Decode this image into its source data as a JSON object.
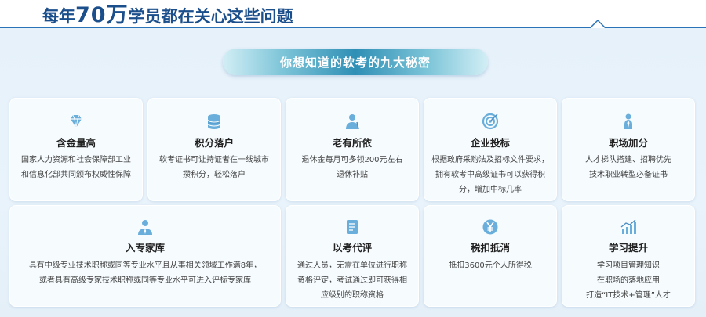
{
  "header": {
    "title_part1": "每年",
    "title_number": "70万",
    "title_part2": "学员都在关心这些问题"
  },
  "banner": {
    "label": "你想知道的软考的九大秘密"
  },
  "cards": [
    {
      "title": "含金量高",
      "icon": "diamond-icon",
      "lines": [
        "国家人力资源和社会保障部工业",
        "和信息化部共同颁布权威性保障"
      ]
    },
    {
      "title": "积分落户",
      "icon": "coin-stack-icon",
      "lines": [
        "软考证书可让持证者在一线城市",
        "攒积分，轻松落户"
      ]
    },
    {
      "title": "老有所依",
      "icon": "elder-person-icon",
      "lines": [
        "退休金每月可多领200元左右",
        "退休补贴"
      ]
    },
    {
      "title": "企业投标",
      "icon": "target-icon",
      "lines": [
        "根据政府采购法及招标文件要求，",
        "拥有软考中高级证书可以获得积",
        "分，增加中标几率"
      ]
    },
    {
      "title": "职场加分",
      "icon": "professional-person-icon",
      "lines": [
        "人才梯队搭建、招聘优先",
        "技术职业转型必备证书"
      ]
    },
    {
      "title": "入专家库",
      "icon": "expert-person-icon",
      "lines": [
        "具有中级专业技术职称或同等专业水平且从事相关领域工作满8年，",
        "或者具有高级专家技术职称或同等专业水平可进入评标专家库"
      ]
    },
    {
      "title": "以考代评",
      "icon": "document-icon",
      "lines": [
        "通过人员，无需在单位进行职称",
        "资格评定，考试通过即可获得相",
        "应级别的职称资格"
      ]
    },
    {
      "title": "税扣抵消",
      "icon": "yen-coin-icon",
      "lines": [
        "抵扣3600元个人所得税"
      ]
    },
    {
      "title": "学习提升",
      "icon": "growth-chart-icon",
      "lines": [
        "学习项目管理知识",
        "在职场的落地应用",
        "打造“IT技术+管理”人才"
      ]
    }
  ],
  "colors": {
    "heading": "#1b4f8c",
    "accent_line": "#2b73b8",
    "icon_blue": "#6aaedb",
    "banner_center": "#2f8fb5"
  }
}
